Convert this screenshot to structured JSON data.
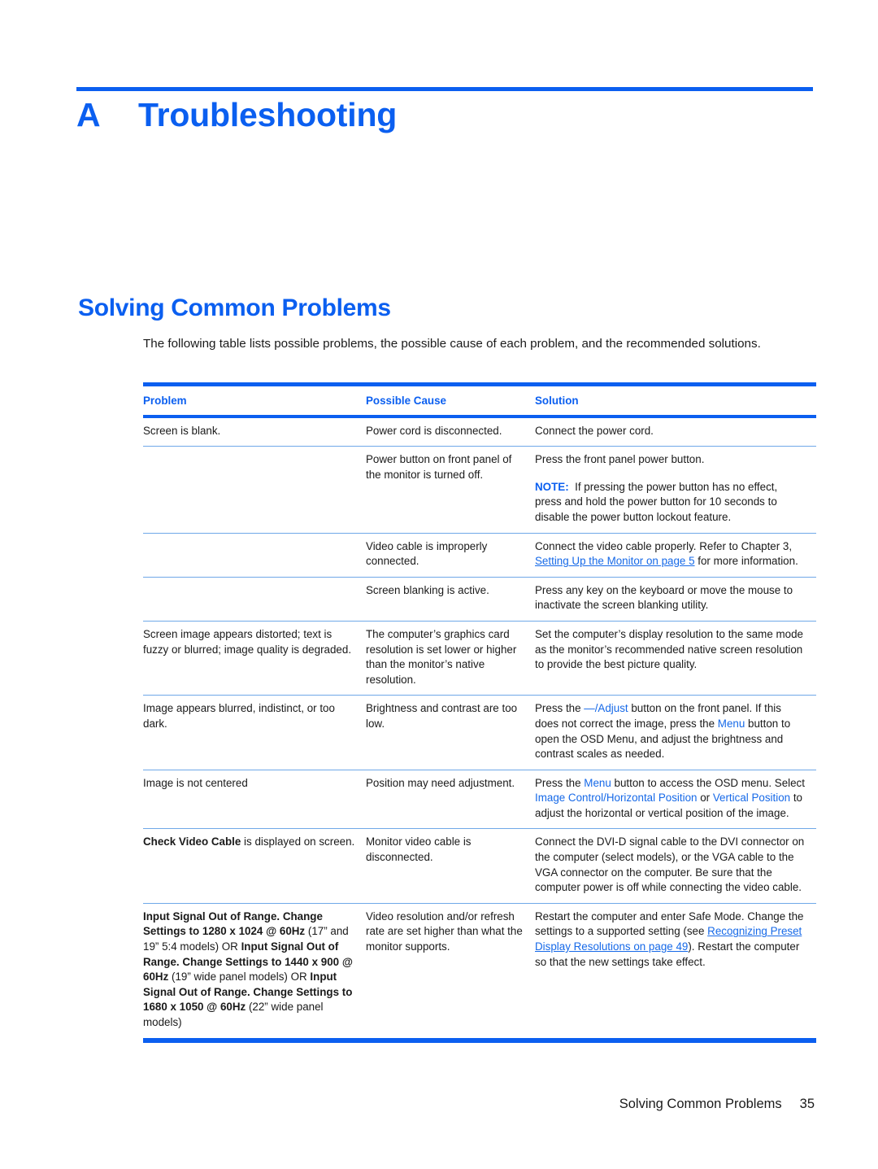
{
  "chapter": {
    "letter": "A",
    "title": "Troubleshooting"
  },
  "section": {
    "heading": "Solving Common Problems",
    "intro": "The following table lists possible problems, the possible cause of each problem, and the recommended solutions."
  },
  "table": {
    "headers": {
      "problem": "Problem",
      "cause": "Possible Cause",
      "solution": "Solution"
    },
    "rows": [
      {
        "problem": "Screen is blank.",
        "cause": "Power cord is disconnected.",
        "solution": "Connect the power cord."
      },
      {
        "problem": "",
        "cause": "Power button on front panel of the monitor is turned off.",
        "solution_line1": "Press the front panel power button.",
        "note_label": "NOTE:",
        "note_text": "If pressing the power button has no effect, press and hold the power button for 10 seconds to disable the power button lockout feature."
      },
      {
        "problem": "",
        "cause": "Video cable is improperly connected.",
        "solution_pre": "Connect the video cable properly. Refer to Chapter 3, ",
        "solution_link": "Setting Up the Monitor on page 5",
        "solution_post": " for more information."
      },
      {
        "problem": "",
        "cause": "Screen blanking is active.",
        "solution": "Press any key on the keyboard or move the mouse to inactivate the screen blanking utility."
      },
      {
        "problem": "Screen image appears distorted; text is fuzzy or blurred; image quality is degraded.",
        "cause": "The computer’s graphics card resolution is set lower or higher than the monitor’s native resolution.",
        "solution": "Set the computer’s display resolution to the same mode as the monitor’s recommended native screen resolution to provide the best picture quality."
      },
      {
        "problem": "Image appears blurred, indistinct, or too dark.",
        "cause": "Brightness and contrast are too low.",
        "solution_p1": "Press the ",
        "solution_term1": "—/Adjust",
        "solution_p2": " button on the front panel. If this does not correct the image, press the ",
        "solution_term2": "Menu",
        "solution_p3": " button to open the OSD Menu, and adjust the brightness and contrast scales as needed."
      },
      {
        "problem": "Image is not centered",
        "cause": "Position may need adjustment.",
        "solution_p1": "Press the ",
        "solution_term1": "Menu",
        "solution_p2": " button to access the OSD menu. Select ",
        "solution_term2": "Image Control/Horizontal Position",
        "solution_p3": " or ",
        "solution_term3": "Vertical Position",
        "solution_p4": " to adjust the horizontal or vertical position of the image."
      },
      {
        "problem_bold": "Check Video Cable",
        "problem_rest": " is displayed on screen.",
        "cause": "Monitor video cable is disconnected.",
        "solution": "Connect the DVI-D signal cable to the DVI connector on the computer (select models), or the VGA cable to the VGA connector on the computer. Be sure that the computer power is off while connecting the video cable."
      },
      {
        "problem_b1": "Input Signal Out of Range. Change Settings to 1280 x 1024 @ 60Hz",
        "problem_r1": " (17” and 19” 5:4 models) OR ",
        "problem_b2": "Input Signal Out of Range. Change Settings to 1440 x 900 @ 60Hz",
        "problem_r2": " (19” wide panel models) OR ",
        "problem_b3": "Input Signal Out of Range. Change Settings to 1680 x 1050 @ 60Hz",
        "problem_r3": " (22” wide panel models)",
        "cause": "Video resolution and/or refresh rate are set higher than what the monitor supports.",
        "solution_pre": "Restart the computer and enter Safe Mode. Change the settings to a supported setting (see ",
        "solution_link": "Recognizing Preset Display Resolutions on page 49",
        "solution_post": "). Restart the computer so that the new settings take effect."
      }
    ]
  },
  "footer": {
    "label": "Solving Common Problems",
    "page_number": "35"
  }
}
